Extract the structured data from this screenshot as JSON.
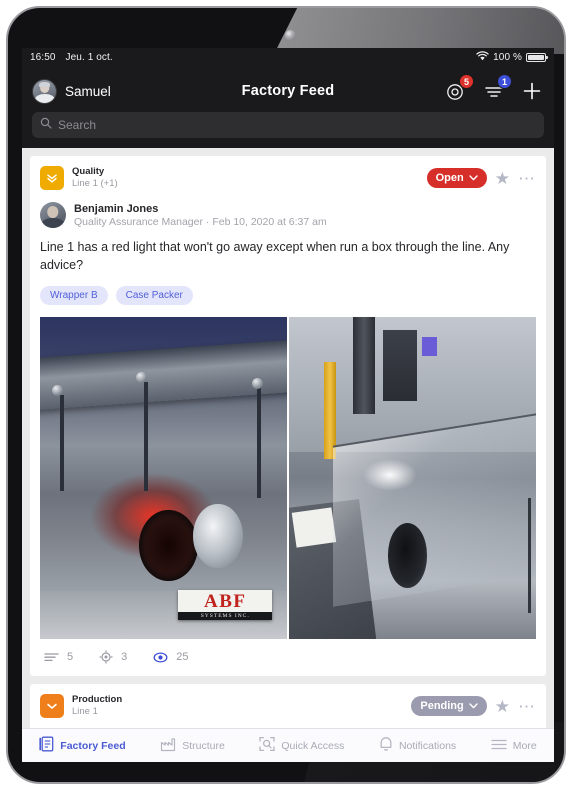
{
  "status_bar": {
    "time": "16:50",
    "date": "Jeu. 1 oct.",
    "battery_text": "100 %",
    "wifi_icon": "wifi-icon",
    "battery_icon": "battery-icon"
  },
  "top_bar": {
    "user_name": "Samuel",
    "title": "Factory Feed",
    "avatar_icon": "user-avatar",
    "actions": [
      {
        "name": "target-icon",
        "badge": "5",
        "badge_color": "#e0322c"
      },
      {
        "name": "filter-icon",
        "badge": "1",
        "badge_color": "#3d4fd6"
      },
      {
        "name": "plus-icon",
        "badge": "",
        "badge_color": ""
      }
    ]
  },
  "search": {
    "placeholder": "Search",
    "value": "",
    "icon": "search-icon"
  },
  "feed": {
    "posts": [
      {
        "category": "Quality",
        "location": "Line 1 (+1)",
        "category_color": "#f0ab00",
        "category_icon": "double-chevron-down-icon",
        "status": "Open",
        "status_color": "#d62f2a",
        "star_icon": "star-icon",
        "more_icon": "more-options-icon",
        "author": "Benjamin Jones",
        "author_meta": "Quality Assurance Manager · Feb 10, 2020 at 6:37 am",
        "body": "Line 1 has a red light that won't go away except when run a box through the line. Any advice?",
        "tags": [
          "Wrapper B",
          "Case Packer"
        ],
        "photo_1_logo_main": "ABF",
        "photo_1_logo_sub": "SYSTEMS INC.",
        "stats": [
          {
            "icon": "lines-icon",
            "value": "5"
          },
          {
            "icon": "target-icon",
            "value": "3"
          },
          {
            "icon": "eye-icon",
            "value": "25"
          }
        ]
      },
      {
        "category": "Production",
        "location": "Line 1",
        "category_color": "#ef7f1a",
        "category_icon": "chevron-down-icon",
        "status": "Pending",
        "status_color": "#9a9bae",
        "star_icon": "star-icon",
        "more_icon": "more-options-icon"
      }
    ]
  },
  "tab_bar": {
    "items": [
      {
        "label": "Factory Feed",
        "icon": "feed-icon",
        "active": true
      },
      {
        "label": "Structure",
        "icon": "factory-icon",
        "active": false
      },
      {
        "label": "Quick Access",
        "icon": "scan-search-icon",
        "active": false
      },
      {
        "label": "Notifications",
        "icon": "bell-icon",
        "active": false
      },
      {
        "label": "More",
        "icon": "hamburger-icon",
        "active": false
      }
    ]
  },
  "colors": {
    "accent_blue": "#4a5bd4",
    "status_open": "#d62f2a",
    "status_pending": "#9a9bae",
    "quality_yellow": "#f0ab00",
    "production_orange": "#ef7f1a",
    "tag_bg": "#e3e5fb",
    "tag_text": "#5160d8"
  }
}
